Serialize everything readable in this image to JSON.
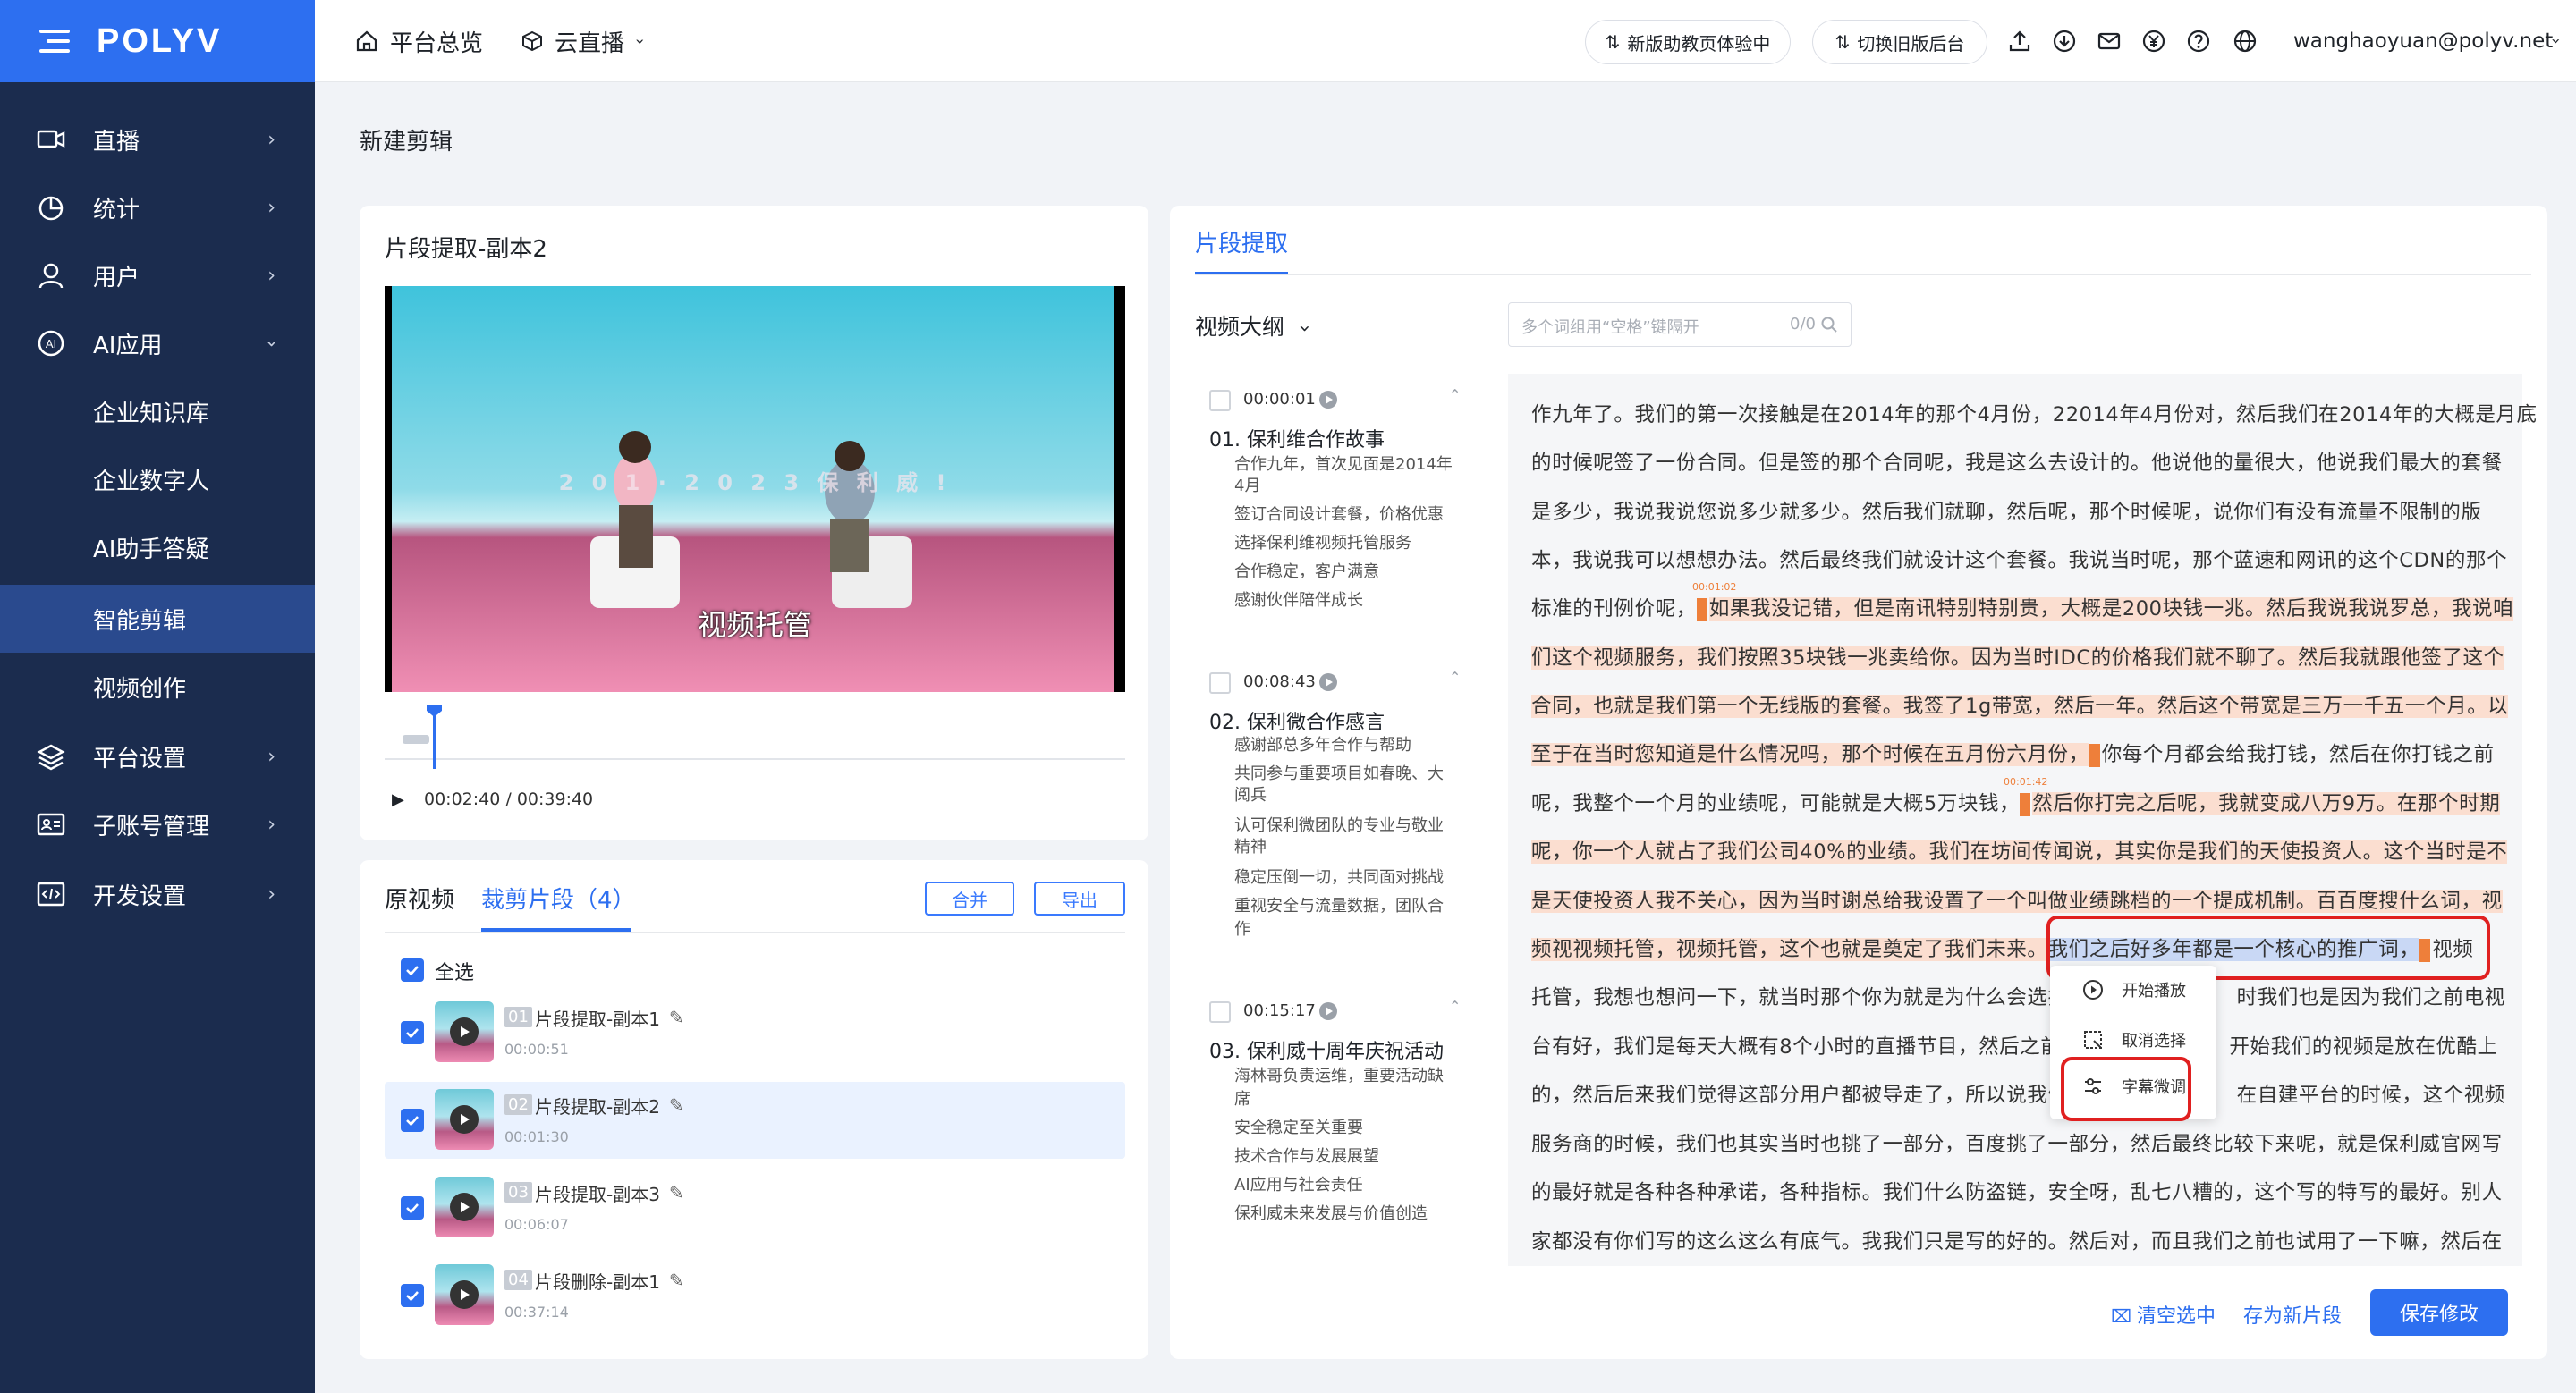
{
  "brand": {
    "logo_text": "POLYV",
    "primary_color": "#2d6ff0",
    "sidebar_color": "#1b2c4e"
  },
  "sidebar": {
    "items": [
      {
        "label": "直播",
        "icon": "live-icon"
      },
      {
        "label": "统计",
        "icon": "stats-icon"
      },
      {
        "label": "用户",
        "icon": "user-icon"
      },
      {
        "label": "AI应用",
        "icon": "ai-icon"
      },
      {
        "label": "平台设置",
        "icon": "layers-icon"
      },
      {
        "label": "子账号管理",
        "icon": "id-card-icon"
      },
      {
        "label": "开发设置",
        "icon": "code-icon"
      }
    ],
    "sub_items": [
      "企业知识库",
      "企业数字人",
      "AI助手答疑",
      "智能剪辑",
      "视频创作"
    ],
    "active_sub": "智能剪辑"
  },
  "header": {
    "home_label": "平台总览",
    "product_label": "云直播",
    "btn_new_assistant": "新版助教页体验中",
    "btn_old_backend": "切换旧版后台",
    "user_email": "wanghaoyuan@polyv.net"
  },
  "page": {
    "title": "新建剪辑"
  },
  "player": {
    "clip_title": "片段提取-副本2",
    "subtitle": "视频托管",
    "banner_text": "2 0 1 · 2 0 2 3   保 利 威 !",
    "current_time": "00:02:40",
    "total_time": "00:39:40",
    "time_display": "00:02:40 / 00:39:40"
  },
  "segments": {
    "tab_original": "原视频",
    "tab_clips": "裁剪片段（4）",
    "merge_label": "合并",
    "export_label": "导出",
    "select_all": "全选",
    "items": [
      {
        "num": "01",
        "name": "片段提取-副本1",
        "duration": "00:00:51"
      },
      {
        "num": "02",
        "name": "片段提取-副本2",
        "duration": "00:01:30"
      },
      {
        "num": "03",
        "name": "片段提取-副本3",
        "duration": "00:06:07"
      },
      {
        "num": "04",
        "name": "片段删除-副本1",
        "duration": "00:37:14"
      }
    ]
  },
  "right": {
    "tab_label": "片段提取",
    "outline_label": "视频大纲",
    "search_placeholder": "多个词组用“空格”键隔开",
    "search_count": "0/0",
    "outline": [
      {
        "time": "00:00:01",
        "title": "01. 保利维合作故事",
        "items": [
          "合作九年，首次见面是2014年",
          "4月",
          "签订合同设计套餐，价格优惠",
          "选择保利维视频托管服务",
          "合作稳定，客户满意",
          "感谢伙伴陪伴成长"
        ]
      },
      {
        "time": "00:08:43",
        "title": "02. 保利微合作感言",
        "items": [
          "感谢部总多年合作与帮助",
          "共同参与重要项目如春晚、大",
          "阅兵",
          "认可保利微团队的专业与敬业",
          "精神",
          "稳定压倒一切，共同面对挑战",
          "重视安全与流量数据，团队合",
          "作"
        ]
      },
      {
        "time": "00:15:17",
        "title": "03. 保利威十周年庆祝活动",
        "items": [
          "海林哥负责运维，重要活动缺",
          "席",
          "安全稳定至关重要",
          "技术合作与发展展望",
          "AI应用与社会责任",
          "保利威未来发展与价值创造"
        ]
      }
    ],
    "transcript": {
      "l1": "作九年了。我们的第一次接触是在2014年的那个4月份，22014年4月份对，然后我们在2014年的大概是月底",
      "l2": "的时候呢签了一份合同。但是签的那个合同呢，我是这么去设计的。他说他的量很大，他说我们最大的套餐",
      "l3": "是多少，我说我说您说多少就多少。然后我们就聊，然后呢，那个时候呢，说你们有没有流量不限制的版",
      "l4": "本，我说我可以想想办法。然后最终我们就设计这个套餐。我说当时呢，那个蓝速和网讯的这个CDN的那个",
      "l5a": "标准的刊例价呢，",
      "l5b": "如果我没记错，但是南讯特别特别贵，大概是200块钱一兆。然后我说我说罗总，我说咱",
      "mk1": "00:01:02",
      "l6": "们这个视频服务，我们按照35块钱一兆卖给你。因为当时IDC的价格我们就不聊了。然后我就跟他签了这个",
      "l7": "合同，也就是我们第一个无线版的套餐。我签了1g带宽，然后一年。然后这个带宽是三万一千五一个月。以",
      "l8a": "至于在当时您知道是什么情况吗，那个时候在五月份六月份，",
      "l8b": "你每个月都会给我打钱，然后在你打钱之前",
      "l9a": "呢，我整个一个月的业绩呢，可能就是大概5万块钱，",
      "l9b": "然后你打完之后呢，我就变成八万9万。在那个时期",
      "mk2": "00:01:42",
      "l10": "呢，你一个人就占了我们公司40%的业绩。我们在坊间传闻说，其实你是我们的天使投资人。这个当时是不",
      "l11": "是天使投资人我不关心，因为当时谢总给我设置了一个叫做业绩跳档的一个提成机制。百百度搜什么词，视",
      "l12a": "频视视频托管，视频托管，这个也就是奠定了我们未来。",
      "l12b": "我们之后好多年都是一个核心的推广词，",
      "l12c": "视频",
      "l13a": "托管，我想也想问一下，就当时那个你为就是为什么会选择",
      "l13b": "时我们也是因为我们之前电视",
      "l14a": "台有好，我们是每天大概有8个小时的直播节目，然后之前",
      "l14b": "开始我们的视频是放在优酷上",
      "l15a": "的，然后后来我们觉得这部分用户都被导走了，所以说我们",
      "l15b": "在自建平台的时候，这个视频",
      "l16": "服务商的时候，我们也其实当时也挑了一部分，百度挑了一部分，然后最终比较下来呢，就是保利威官网写",
      "l17": "的最好就是各种各种承诺，各种指标。我们什么防盗链，安全呀，乱七八糟的，这个写的特写的最好。别人",
      "l18": "家都没有你们写的这么这么有底气。我我们只是写的好的。然后对，而且我们之前也试用了一下嘛，然后在"
    },
    "context_menu": [
      "开始播放",
      "取消选择",
      "字幕微调"
    ],
    "btn_clear": "清空选中",
    "btn_save_new": "存为新片段",
    "btn_save": "保存修改"
  }
}
